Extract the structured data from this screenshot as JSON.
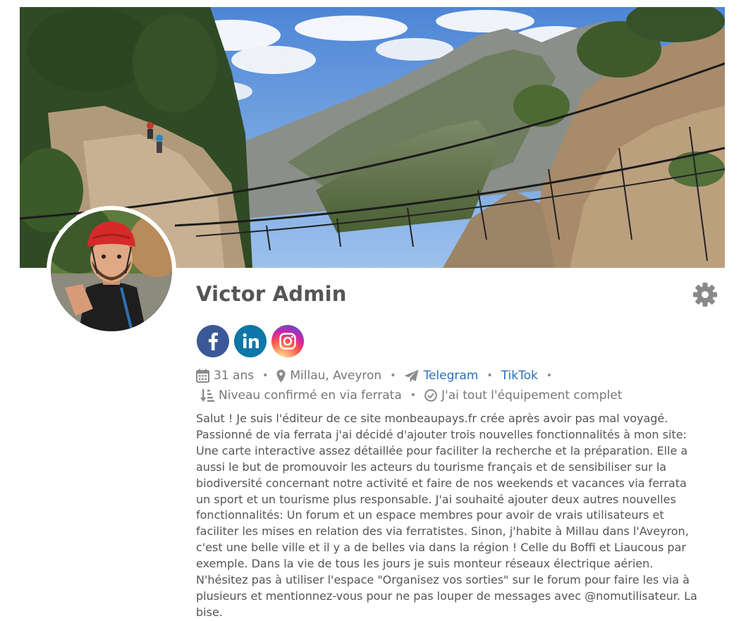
{
  "profile": {
    "name": "Victor Admin",
    "age": "31 ans",
    "location": "Millau, Aveyron",
    "level": "Niveau confirmé en via ferrata",
    "equipment": "J'ai tout l'équipement complet",
    "links": {
      "telegram": "Telegram",
      "tiktok": "TikTok"
    },
    "bio": "Salut ! Je suis l'éditeur de ce site monbeaupays.fr crée après avoir pas mal voyagé. Passionné de via ferrata j'ai décidé d'ajouter trois nouvelles fonctionnalités à mon site: Une carte interactive assez détaillée pour faciliter la recherche et la préparation. Elle a aussi le but de promouvoir les acteurs du tourisme français et de sensibiliser sur la biodiversité concernant notre activité et faire de nos weekends et vacances via ferrata un sport et un tourisme plus responsable. J'ai souhaité ajouter deux autres nouvelles fonctionnalités: Un forum et un espace membres pour avoir de vrais utilisateurs et faciliter les mises en relation des via ferratistes. Sinon, j'habite à Millau dans l'Aveyron, c'est une belle ville et il y a de belles via dans la région ! Celle du Boffi et Liaucous par exemple. Dans la vie de tous les jours je suis monteur réseaux électrique aérien. N'hésitez pas à utiliser l'espace \"Organisez vos sorties\" sur le forum pour faire les via à plusieurs et mentionnez-vous pour ne pas louper de messages avec @nomutilisateur. La bise."
  },
  "socials": [
    {
      "name": "facebook",
      "icon": "facebook-icon",
      "color": "#3b5998"
    },
    {
      "name": "linkedin",
      "icon": "linkedin-icon",
      "color": "#0e76a8"
    },
    {
      "name": "instagram",
      "icon": "instagram-icon",
      "color": "#d6249f"
    }
  ],
  "icons": {
    "age": "calendar-icon",
    "location": "map-marker-icon",
    "telegram": "paper-plane-icon",
    "level": "sort-level-icon",
    "equipment": "check-circle-icon",
    "settings": "gear-icon"
  },
  "colors": {
    "link": "#2a6ebb",
    "text": "#555555",
    "muted": "#777777"
  }
}
